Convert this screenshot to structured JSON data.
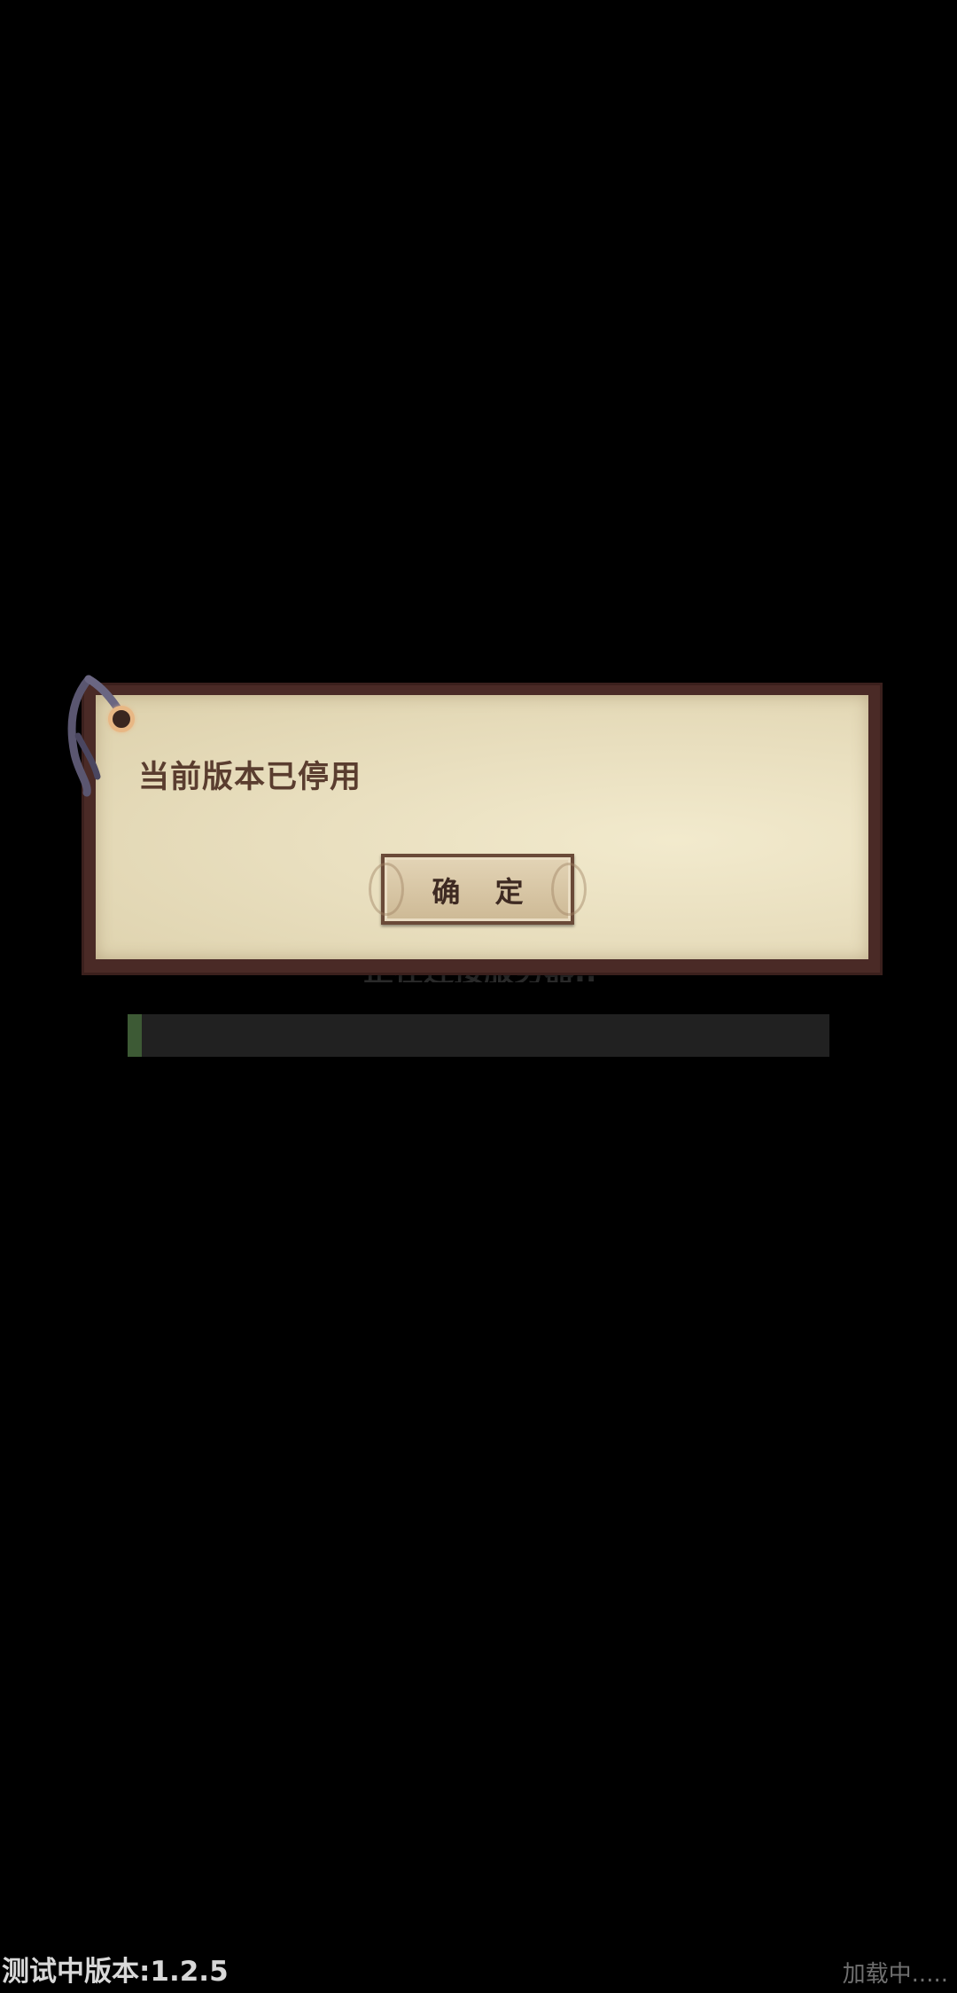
{
  "loading": {
    "status_text": "正在连接服务器...",
    "progress": 0.02,
    "indicator_text": "加载中....."
  },
  "dialog": {
    "message": "当前版本已停用",
    "confirm_label": "确 定"
  },
  "footer": {
    "version_text": "测试中版本:1.2.5"
  },
  "colors": {
    "background": "#000000",
    "paper": "#e9dfbf",
    "frame": "#4a2a26",
    "message_text": "#5a3d2f",
    "progress_fill": "#3d5a35",
    "progress_track": "#212121"
  },
  "icons": {
    "tag": "tag-hole-icon",
    "string": "tag-string-icon"
  }
}
